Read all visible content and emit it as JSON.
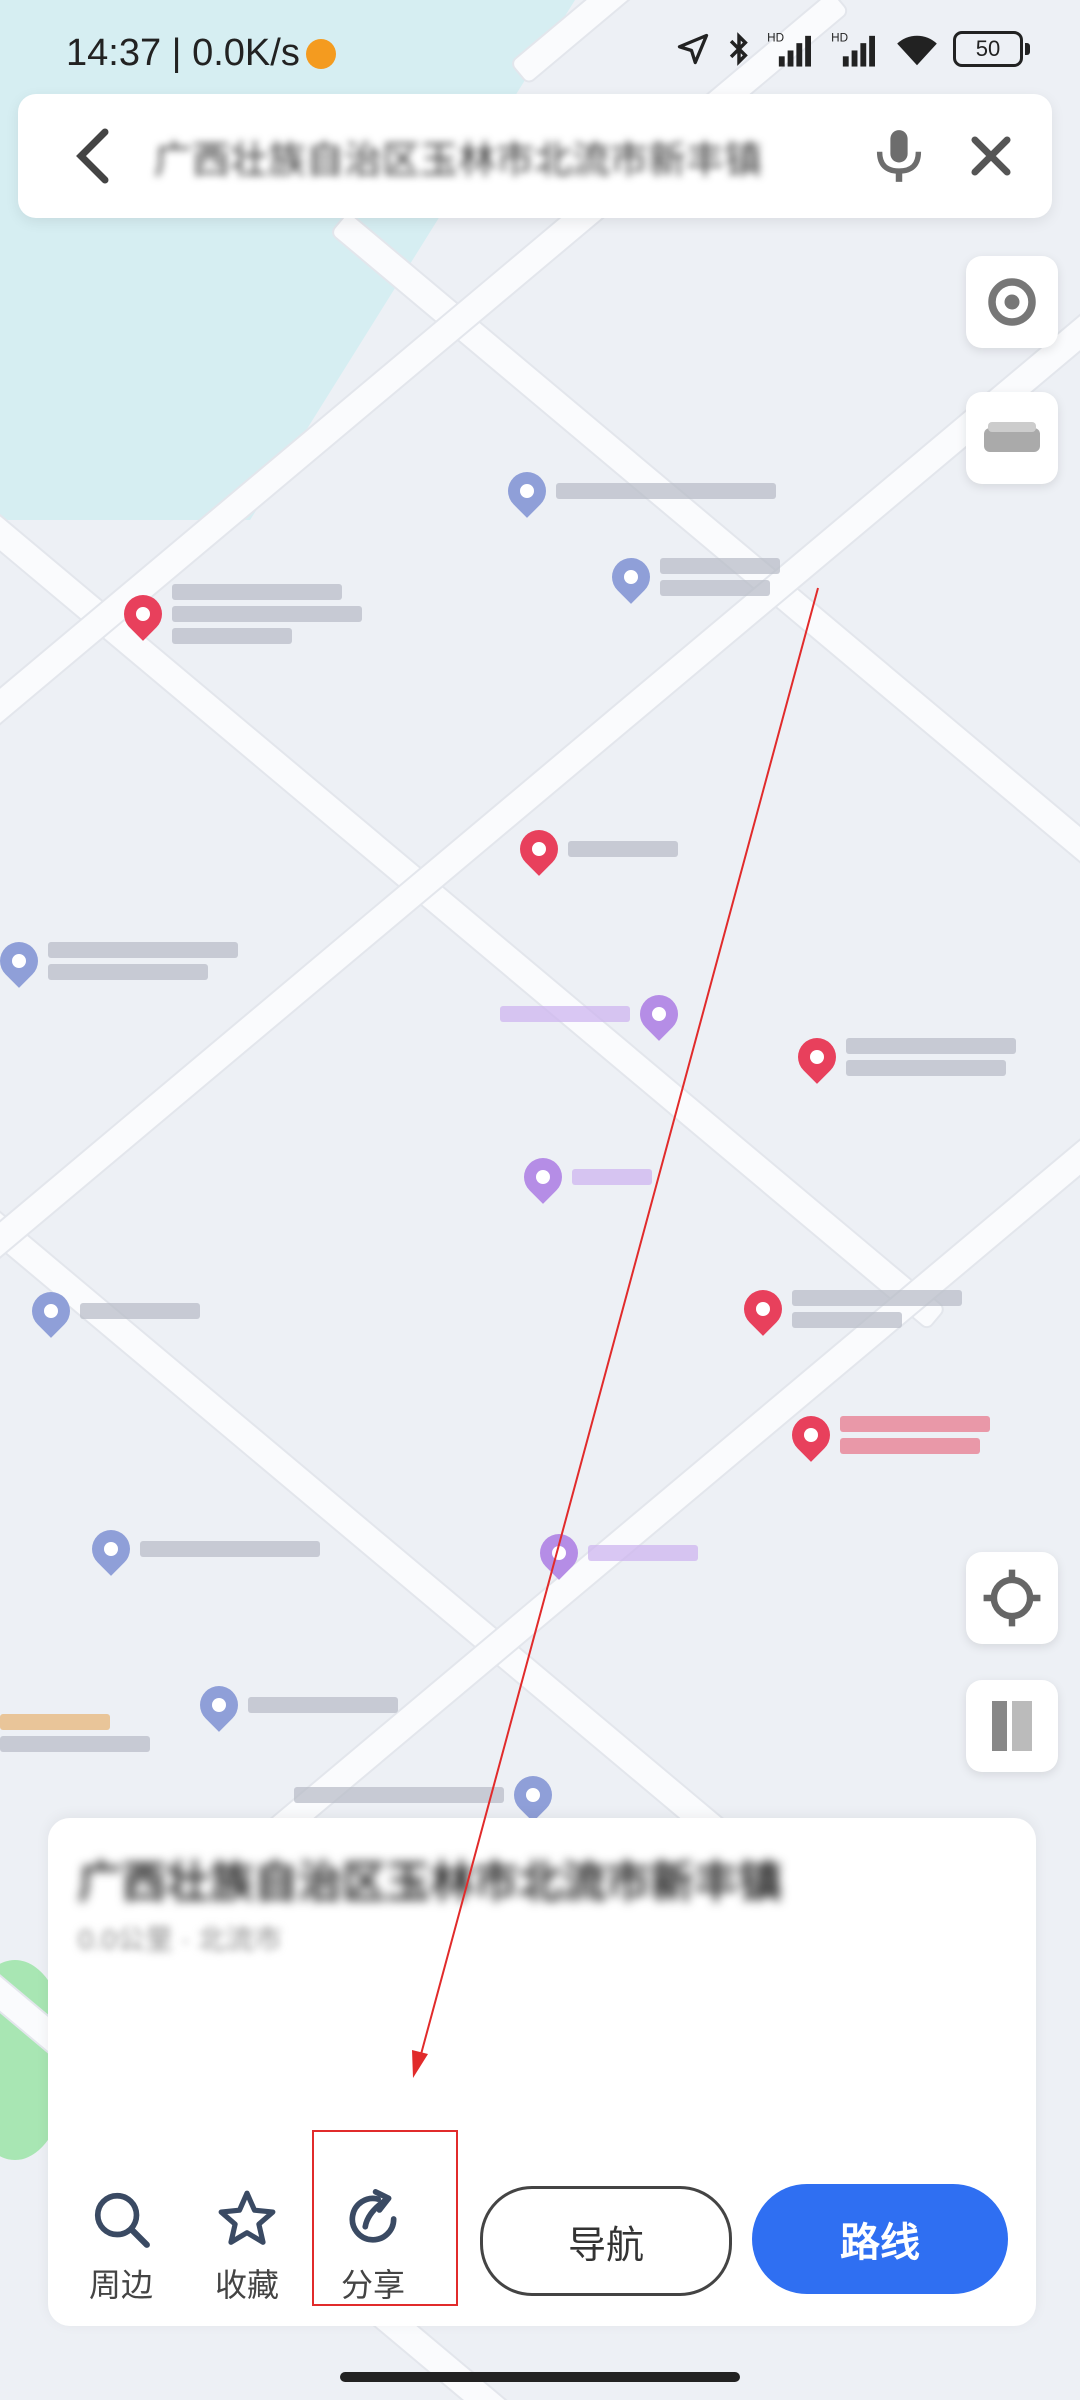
{
  "status_bar": {
    "time": "14:37",
    "net_speed": "0.0K/s",
    "battery": "50",
    "icons": [
      "location-arrow-icon",
      "bluetooth-icon",
      "hd-signal-icon",
      "hd-signal-icon",
      "wifi-icon",
      "battery-icon"
    ]
  },
  "search_bar": {
    "title": "广西壮族自治区玉林市北流市新丰镇",
    "back_icon": "back-arrow-icon",
    "mic_icon": "microphone-icon",
    "close_icon": "close-icon"
  },
  "place_card": {
    "name": "广西壮族自治区玉林市北流市新丰镇",
    "meta": "0.0公里 · 北流市",
    "actions": [
      {
        "label": "周边",
        "icon": "search-icon"
      },
      {
        "label": "收藏",
        "icon": "star-icon"
      },
      {
        "label": "分享",
        "icon": "share-icon"
      }
    ],
    "nav_button": "导航",
    "route_button": "路线"
  },
  "colors": {
    "primary": "#2f6ff2",
    "highlight": "#e12b2b",
    "poi_red": "#e8405c",
    "poi_blue": "#8f9fd8",
    "poi_purple": "#b58de6"
  }
}
